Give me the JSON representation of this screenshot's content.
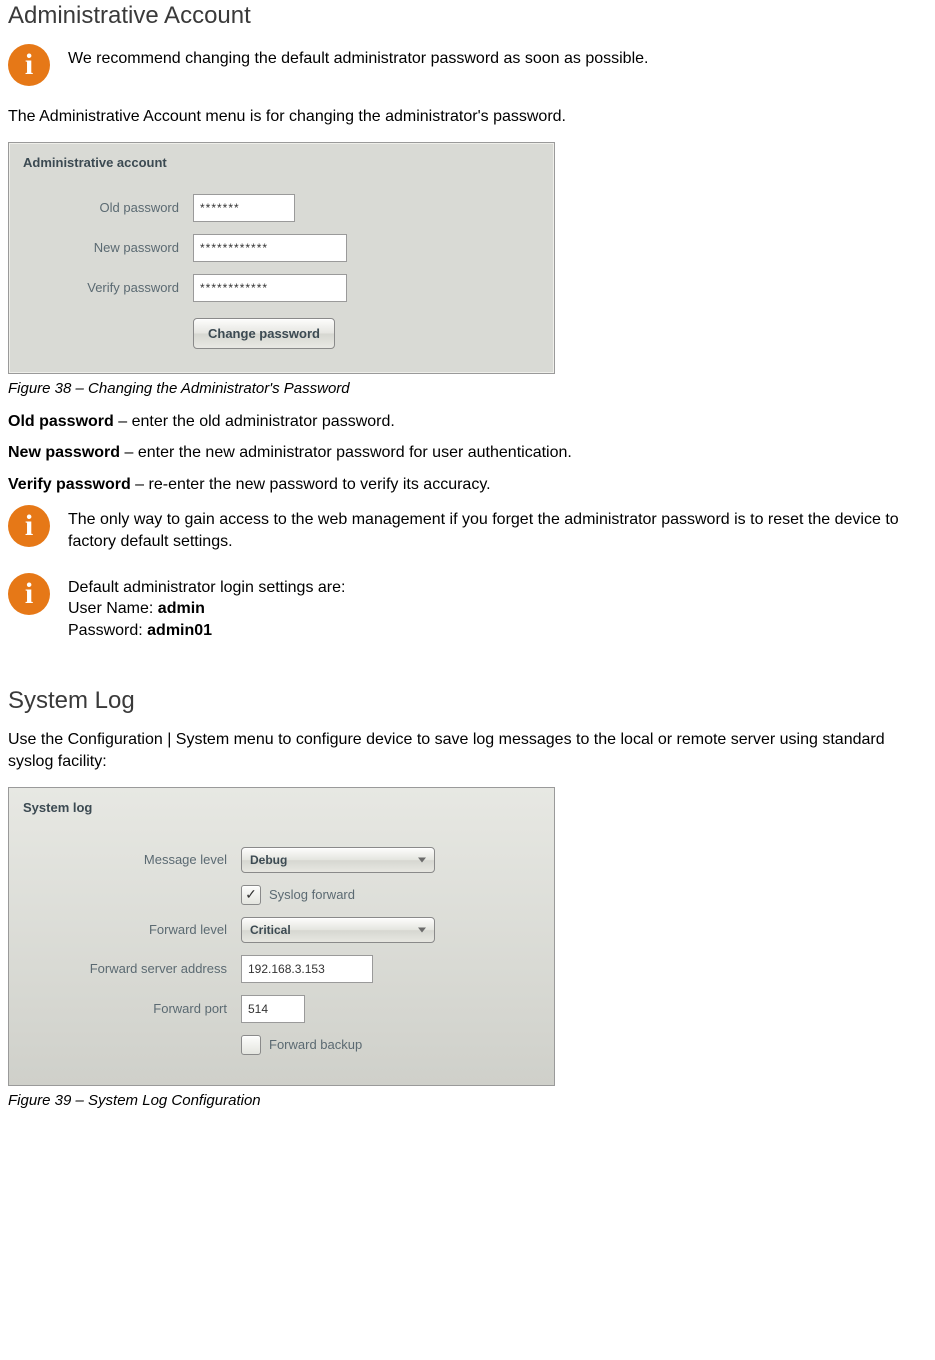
{
  "section1": {
    "heading": "Administrative Account",
    "info1": "We recommend changing the default administrator password as soon as possible.",
    "intro": "The Administrative Account menu is for changing the administrator's password.",
    "panel_title": "Administrative account",
    "labels": {
      "old": "Old password",
      "new": "New password",
      "verify": "Verify password"
    },
    "values": {
      "old": "*******",
      "new": "************",
      "verify": "************"
    },
    "button": "Change password",
    "figure_caption": "Figure 38 – Changing the Administrator's Password",
    "def_old_label": "Old password",
    "def_old_text": " – enter the old administrator password.",
    "def_new_label": "New password",
    "def_new_text": " – enter the new administrator password for user authentication.",
    "def_verify_label": "Verify password",
    "def_verify_text": " – re-enter the new password to verify its accuracy.",
    "info2": "The only way to gain access to the web management if you forget the administrator password is to reset the device to factory default settings.",
    "info3_line1": "Default administrator login settings are:",
    "info3_user_label": "User Name: ",
    "info3_user_value": "admin",
    "info3_pass_label": "Password: ",
    "info3_pass_value": "admin01"
  },
  "section2": {
    "heading": "System Log",
    "intro": "Use the Configuration | System menu to configure device to save log messages to the local or remote server using standard syslog facility:",
    "panel_title": "System log",
    "labels": {
      "msg_level": "Message level",
      "syslog_forward": "Syslog forward",
      "fwd_level": "Forward level",
      "fwd_server": "Forward server address",
      "fwd_port": "Forward port",
      "fwd_backup": "Forward backup"
    },
    "values": {
      "msg_level": "Debug",
      "syslog_forward_checked": true,
      "fwd_level": "Critical",
      "fwd_server": "192.168.3.153",
      "fwd_port": "514",
      "fwd_backup_checked": false
    },
    "figure_caption": "Figure 39 – System Log Configuration"
  }
}
